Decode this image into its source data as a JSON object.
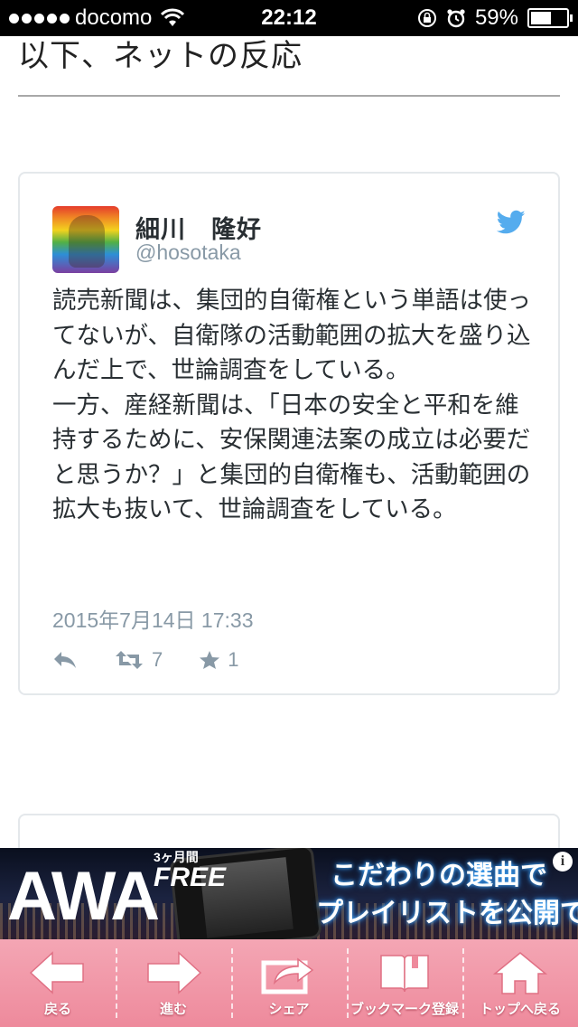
{
  "status_bar": {
    "carrier": "docomo",
    "time": "22:12",
    "battery": "59%",
    "battery_level": 0.59
  },
  "section": {
    "heading": "以下、ネットの反応"
  },
  "tweet": {
    "author_name": "細川　隆好",
    "handle": "@hosotaka",
    "text": "読売新聞は、集団的自衛権という単語は使ってないが、自衛隊の活動範囲の拡大を盛り込んだ上で、世論調査をしている。\n一方、産経新聞は、「日本の安全と平和を維持するために、安保関連法案の成立は必要だと思うか？」と集団的自衛権も、活動範囲の拡大も抜いて、世論調査をしている。",
    "date": "2015年7月14日 17:33",
    "retweet_count": "7",
    "favorite_count": "1"
  },
  "ad": {
    "brand": "AWA",
    "free_badge_top": "3ヶ月間",
    "free_badge": "FREE",
    "copy_line1": "こだわりの選曲で",
    "copy_line2": "プレイリストを公開できる",
    "info": "i"
  },
  "bottom_nav": {
    "items": [
      {
        "label": "戻る",
        "icon": "arrow-left-icon"
      },
      {
        "label": "進む",
        "icon": "arrow-right-icon"
      },
      {
        "label": "シェア",
        "icon": "share-icon"
      },
      {
        "label": "ブックマーク登録",
        "icon": "bookmark-book-icon"
      },
      {
        "label": "トップへ戻る",
        "icon": "home-icon"
      }
    ],
    "background": "#ee8a9c"
  },
  "colors": {
    "twitter_blue": "#55acee",
    "meta_gray": "#8899a6"
  }
}
